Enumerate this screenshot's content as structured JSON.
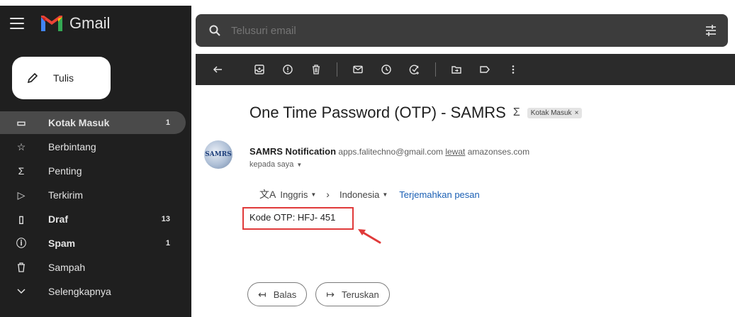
{
  "app": {
    "name": "Gmail"
  },
  "compose": {
    "label": "Tulis"
  },
  "nav": [
    {
      "label": "Kotak Masuk",
      "count": "1",
      "icon": "inbox-icon",
      "glyph": "▭"
    },
    {
      "label": "Berbintang",
      "count": "",
      "icon": "star-icon",
      "glyph": "☆"
    },
    {
      "label": "Penting",
      "count": "",
      "icon": "important-icon",
      "glyph": "Σ"
    },
    {
      "label": "Terkirim",
      "count": "",
      "icon": "sent-icon",
      "glyph": "▷"
    },
    {
      "label": "Draf",
      "count": "13",
      "icon": "draft-icon",
      "glyph": "▯"
    },
    {
      "label": "Spam",
      "count": "1",
      "icon": "spam-icon",
      "glyph": "ⓘ"
    },
    {
      "label": "Sampah",
      "count": "",
      "icon": "trash-icon",
      "glyph": "🗑"
    },
    {
      "label": "Selengkapnya",
      "count": "",
      "icon": "chevron-down-icon",
      "glyph": "⌄"
    }
  ],
  "search": {
    "placeholder": "Telusuri email"
  },
  "email": {
    "subject": "One Time Password (OTP) - SAMRS",
    "label_chip": "Kotak Masuk",
    "label_chip_close": "×",
    "sender_name": "SAMRS Notification",
    "sender_email": "apps.falitechno@gmail.com",
    "via_word": "lewat",
    "via_domain": "amazonses.com",
    "recipient": "kepada saya",
    "avatar_text": "SAMRS",
    "body": "Kode OTP: HFJ- 451"
  },
  "translate": {
    "from": "Inggris",
    "to": "Indonesia",
    "link": "Terjemahkan pesan"
  },
  "actions": {
    "reply": "Balas",
    "forward": "Teruskan"
  },
  "colors": {
    "sidebar_bg": "#1f1f1f",
    "toolbar_bg": "#2b2b2b",
    "search_bg": "#3c3c3c",
    "highlight_red": "#e03a3a",
    "link_blue": "#1a5fb4"
  }
}
